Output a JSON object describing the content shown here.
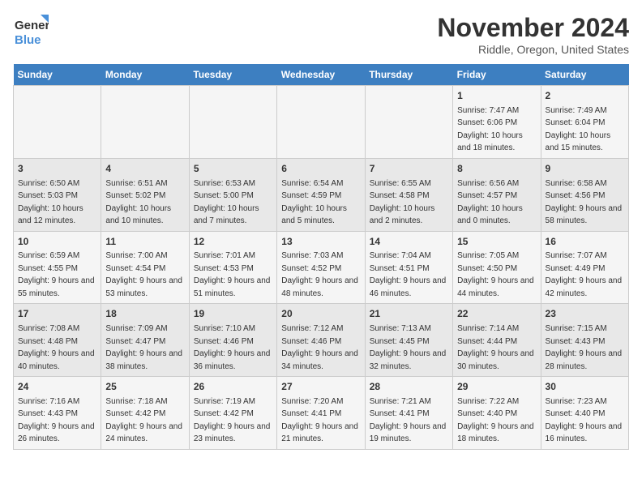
{
  "logo": {
    "line1": "General",
    "line2": "Blue"
  },
  "title": "November 2024",
  "location": "Riddle, Oregon, United States",
  "days_of_week": [
    "Sunday",
    "Monday",
    "Tuesday",
    "Wednesday",
    "Thursday",
    "Friday",
    "Saturday"
  ],
  "weeks": [
    [
      {
        "day": "",
        "info": ""
      },
      {
        "day": "",
        "info": ""
      },
      {
        "day": "",
        "info": ""
      },
      {
        "day": "",
        "info": ""
      },
      {
        "day": "",
        "info": ""
      },
      {
        "day": "1",
        "info": "Sunrise: 7:47 AM\nSunset: 6:06 PM\nDaylight: 10 hours and 18 minutes."
      },
      {
        "day": "2",
        "info": "Sunrise: 7:49 AM\nSunset: 6:04 PM\nDaylight: 10 hours and 15 minutes."
      }
    ],
    [
      {
        "day": "3",
        "info": "Sunrise: 6:50 AM\nSunset: 5:03 PM\nDaylight: 10 hours and 12 minutes."
      },
      {
        "day": "4",
        "info": "Sunrise: 6:51 AM\nSunset: 5:02 PM\nDaylight: 10 hours and 10 minutes."
      },
      {
        "day": "5",
        "info": "Sunrise: 6:53 AM\nSunset: 5:00 PM\nDaylight: 10 hours and 7 minutes."
      },
      {
        "day": "6",
        "info": "Sunrise: 6:54 AM\nSunset: 4:59 PM\nDaylight: 10 hours and 5 minutes."
      },
      {
        "day": "7",
        "info": "Sunrise: 6:55 AM\nSunset: 4:58 PM\nDaylight: 10 hours and 2 minutes."
      },
      {
        "day": "8",
        "info": "Sunrise: 6:56 AM\nSunset: 4:57 PM\nDaylight: 10 hours and 0 minutes."
      },
      {
        "day": "9",
        "info": "Sunrise: 6:58 AM\nSunset: 4:56 PM\nDaylight: 9 hours and 58 minutes."
      }
    ],
    [
      {
        "day": "10",
        "info": "Sunrise: 6:59 AM\nSunset: 4:55 PM\nDaylight: 9 hours and 55 minutes."
      },
      {
        "day": "11",
        "info": "Sunrise: 7:00 AM\nSunset: 4:54 PM\nDaylight: 9 hours and 53 minutes."
      },
      {
        "day": "12",
        "info": "Sunrise: 7:01 AM\nSunset: 4:53 PM\nDaylight: 9 hours and 51 minutes."
      },
      {
        "day": "13",
        "info": "Sunrise: 7:03 AM\nSunset: 4:52 PM\nDaylight: 9 hours and 48 minutes."
      },
      {
        "day": "14",
        "info": "Sunrise: 7:04 AM\nSunset: 4:51 PM\nDaylight: 9 hours and 46 minutes."
      },
      {
        "day": "15",
        "info": "Sunrise: 7:05 AM\nSunset: 4:50 PM\nDaylight: 9 hours and 44 minutes."
      },
      {
        "day": "16",
        "info": "Sunrise: 7:07 AM\nSunset: 4:49 PM\nDaylight: 9 hours and 42 minutes."
      }
    ],
    [
      {
        "day": "17",
        "info": "Sunrise: 7:08 AM\nSunset: 4:48 PM\nDaylight: 9 hours and 40 minutes."
      },
      {
        "day": "18",
        "info": "Sunrise: 7:09 AM\nSunset: 4:47 PM\nDaylight: 9 hours and 38 minutes."
      },
      {
        "day": "19",
        "info": "Sunrise: 7:10 AM\nSunset: 4:46 PM\nDaylight: 9 hours and 36 minutes."
      },
      {
        "day": "20",
        "info": "Sunrise: 7:12 AM\nSunset: 4:46 PM\nDaylight: 9 hours and 34 minutes."
      },
      {
        "day": "21",
        "info": "Sunrise: 7:13 AM\nSunset: 4:45 PM\nDaylight: 9 hours and 32 minutes."
      },
      {
        "day": "22",
        "info": "Sunrise: 7:14 AM\nSunset: 4:44 PM\nDaylight: 9 hours and 30 minutes."
      },
      {
        "day": "23",
        "info": "Sunrise: 7:15 AM\nSunset: 4:43 PM\nDaylight: 9 hours and 28 minutes."
      }
    ],
    [
      {
        "day": "24",
        "info": "Sunrise: 7:16 AM\nSunset: 4:43 PM\nDaylight: 9 hours and 26 minutes."
      },
      {
        "day": "25",
        "info": "Sunrise: 7:18 AM\nSunset: 4:42 PM\nDaylight: 9 hours and 24 minutes."
      },
      {
        "day": "26",
        "info": "Sunrise: 7:19 AM\nSunset: 4:42 PM\nDaylight: 9 hours and 23 minutes."
      },
      {
        "day": "27",
        "info": "Sunrise: 7:20 AM\nSunset: 4:41 PM\nDaylight: 9 hours and 21 minutes."
      },
      {
        "day": "28",
        "info": "Sunrise: 7:21 AM\nSunset: 4:41 PM\nDaylight: 9 hours and 19 minutes."
      },
      {
        "day": "29",
        "info": "Sunrise: 7:22 AM\nSunset: 4:40 PM\nDaylight: 9 hours and 18 minutes."
      },
      {
        "day": "30",
        "info": "Sunrise: 7:23 AM\nSunset: 4:40 PM\nDaylight: 9 hours and 16 minutes."
      }
    ]
  ]
}
